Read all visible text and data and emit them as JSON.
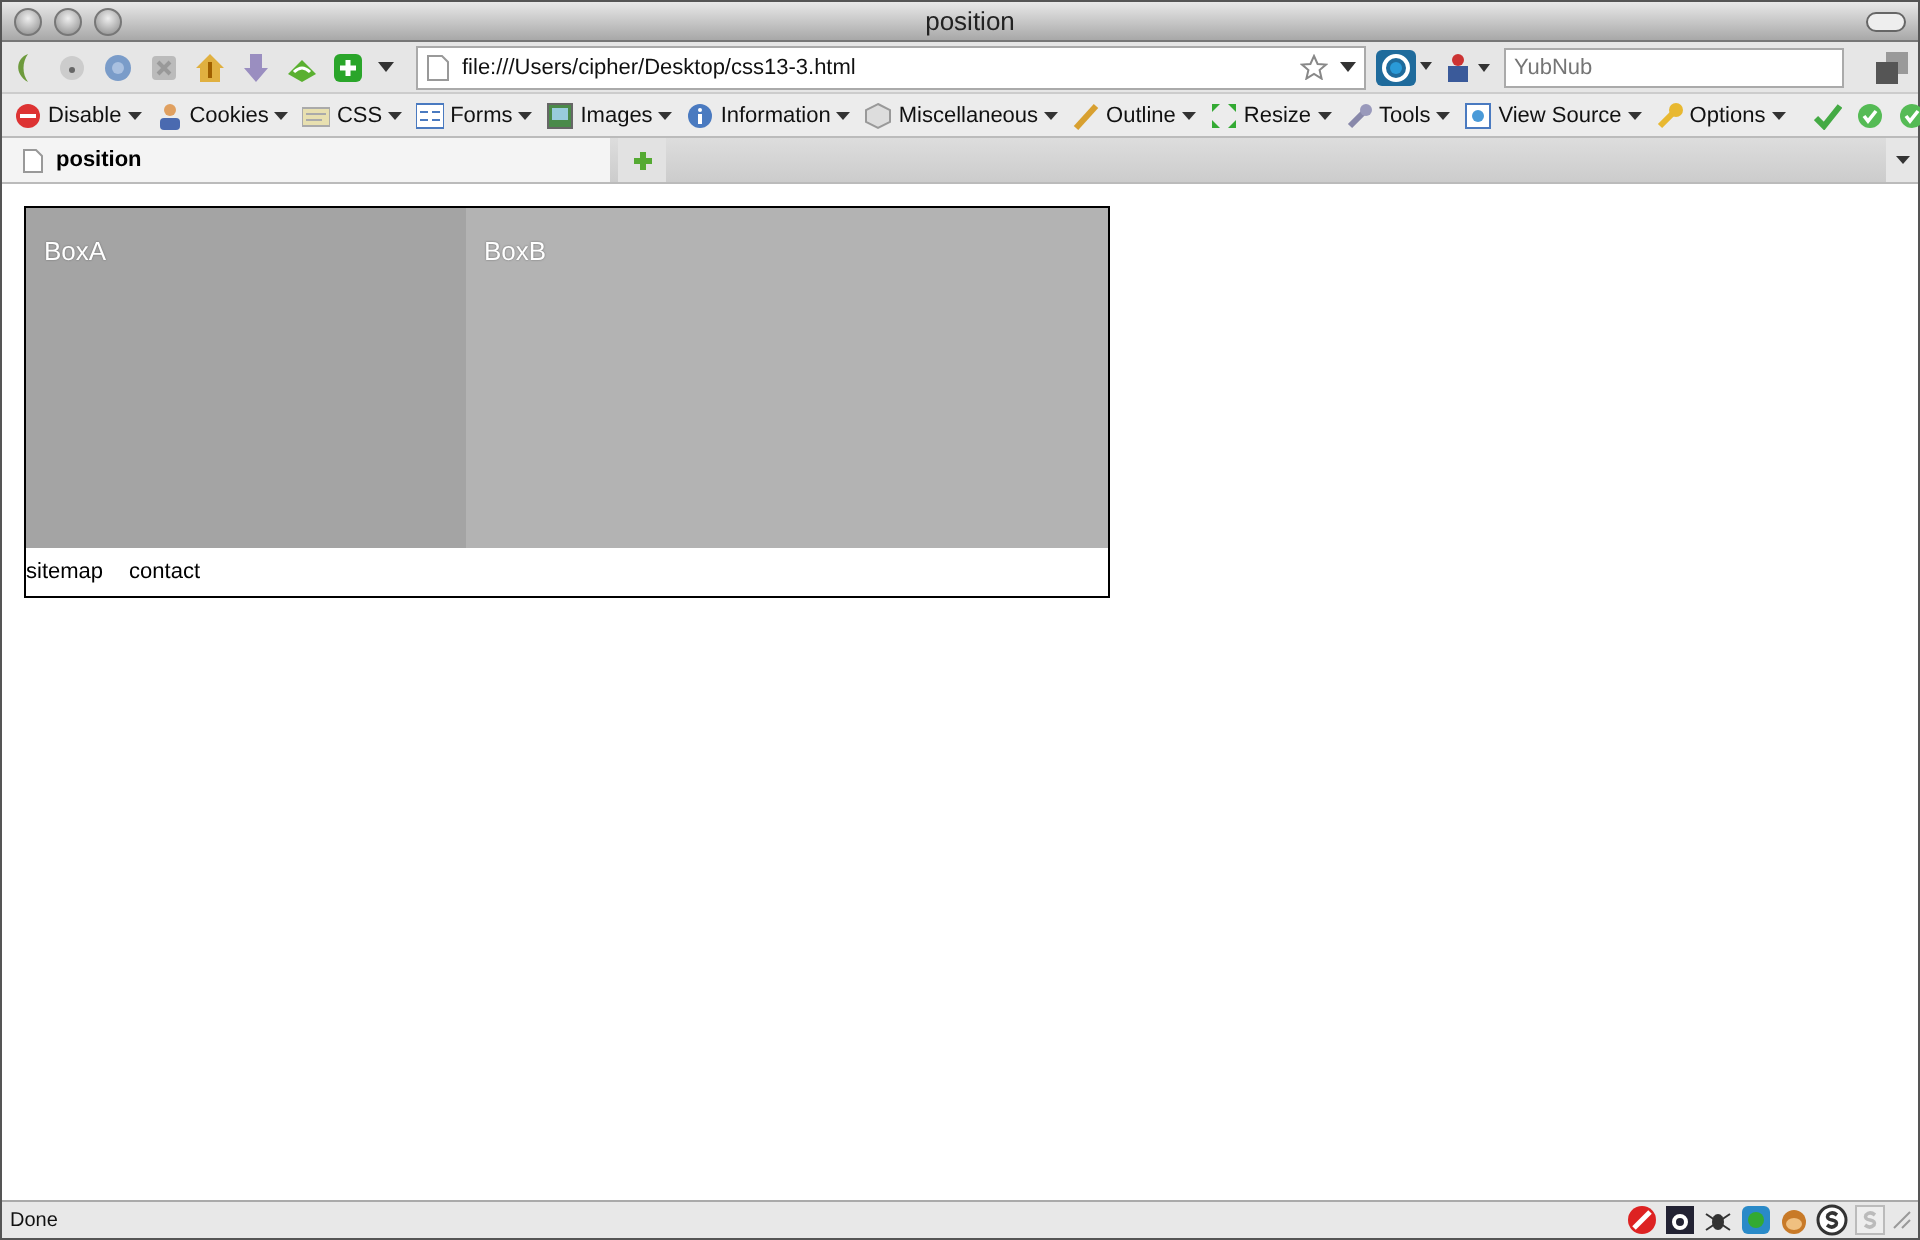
{
  "window": {
    "title": "position"
  },
  "nav_toolbar": {
    "url": "file:///Users/cipher/Desktop/css13-3.html",
    "search": {
      "placeholder": "YubNub"
    }
  },
  "dev_toolbar": {
    "menus": [
      "Disable",
      "Cookies",
      "CSS",
      "Forms",
      "Images",
      "Information",
      "Miscellaneous",
      "Outline",
      "Resize",
      "Tools",
      "View Source",
      "Options"
    ]
  },
  "tabs": [
    {
      "label": "position",
      "selected": true
    }
  ],
  "page": {
    "box_a": "BoxA",
    "box_b": "BoxB",
    "links": [
      "sitemap",
      "contact"
    ]
  },
  "status_bar": {
    "text": "Done"
  }
}
